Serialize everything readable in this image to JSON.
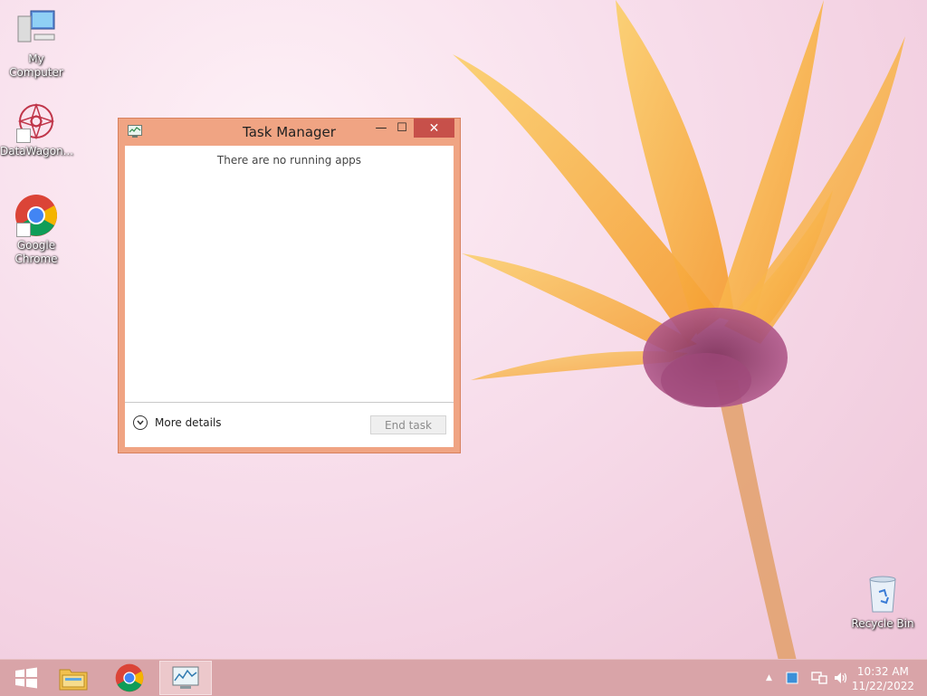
{
  "desktop": {
    "icons": [
      {
        "label": "My Computer"
      },
      {
        "label": "DataWagon..."
      },
      {
        "label": "Google Chrome"
      },
      {
        "label": "Recycle Bin"
      }
    ]
  },
  "window": {
    "title": "Task Manager",
    "empty_message": "There are no running apps",
    "more_details_label": "More details",
    "end_task_label": "End task",
    "minimize_glyph": "—",
    "maximize_glyph": "☐",
    "close_glyph": "✕"
  },
  "taskbar": {
    "items": [
      "start-icon",
      "file-explorer-icon",
      "chrome-icon",
      "task-manager-icon"
    ],
    "tray": {
      "chevron_glyph": "▲",
      "time": "10:32 AM",
      "date": "11/22/2022"
    }
  },
  "colors": {
    "window_frame": "#f0a483",
    "close_button": "#c7504a",
    "taskbar": "#d9a4a8"
  }
}
